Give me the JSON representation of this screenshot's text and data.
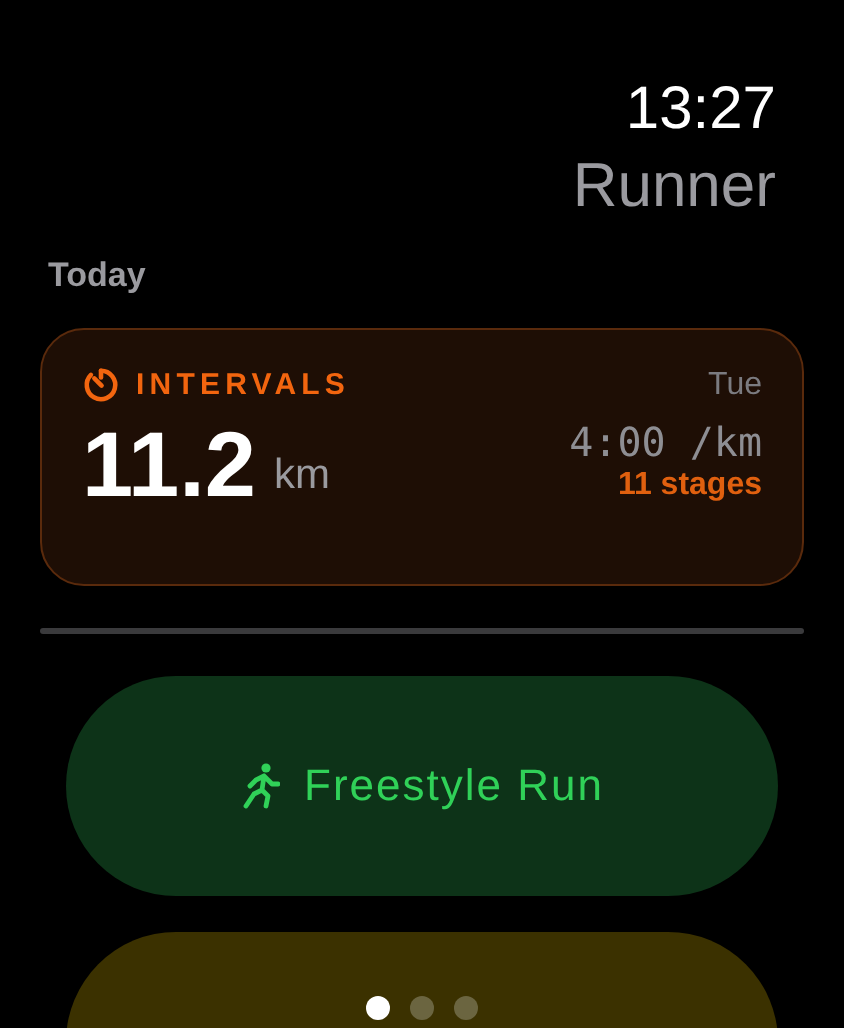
{
  "status": {
    "time": "13:27"
  },
  "app_title": "Runner",
  "section": "Today",
  "workout_card": {
    "type": "INTERVALS",
    "day": "Tue",
    "distance": "11.2",
    "unit": "km",
    "pace": "4:00 /km",
    "stages": "11 stages"
  },
  "start_button": {
    "label": "Freestyle Run"
  },
  "page_dots": [
    {
      "selected": true
    },
    {
      "selected": false
    },
    {
      "selected": false
    }
  ]
}
